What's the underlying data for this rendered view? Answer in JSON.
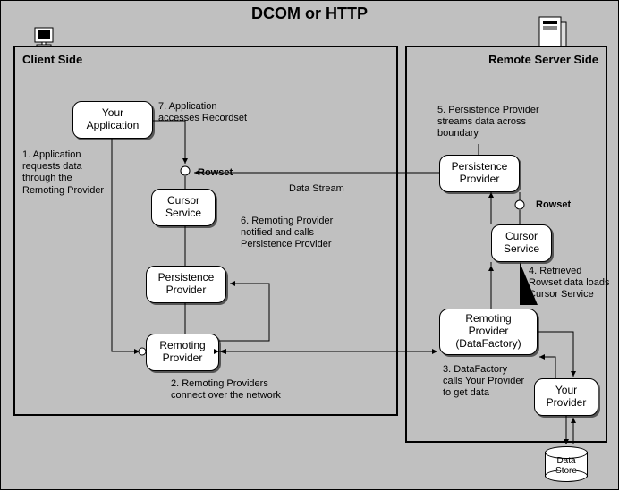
{
  "title": "DCOM or HTTP",
  "client_panel_label": "Client Side",
  "server_panel_label": "Remote Server Side",
  "nodes": {
    "your_app": "Your\nApplication",
    "cursor_client": "Cursor\nService",
    "persist_client": "Persistence\nProvider",
    "remoting_client": "Remoting\nProvider",
    "persist_server": "Persistence\nProvider",
    "cursor_server": "Cursor\nService",
    "remoting_server": "Remoting\nProvider\n(DataFactory)",
    "your_provider": "Your\nProvider"
  },
  "rowset_client": "Rowset",
  "rowset_server": "Rowset",
  "data_stream": "Data Stream",
  "data_store": "Data\nStore",
  "steps": {
    "s1": "1. Application\nrequests data\nthrough the\nRemoting Provider",
    "s2": "2. Remoting Providers\nconnect over the network",
    "s3": "3. DataFactory\ncalls Your Provider\nto get data",
    "s4": "4. Retrieved\nRowset data loads\nCursor Service",
    "s5": "5. Persistence Provider\nstreams data across\nboundary",
    "s6": "6. Remoting Provider\nnotified and calls\nPersistence Provider",
    "s7": "7. Application\naccesses Recordset"
  }
}
